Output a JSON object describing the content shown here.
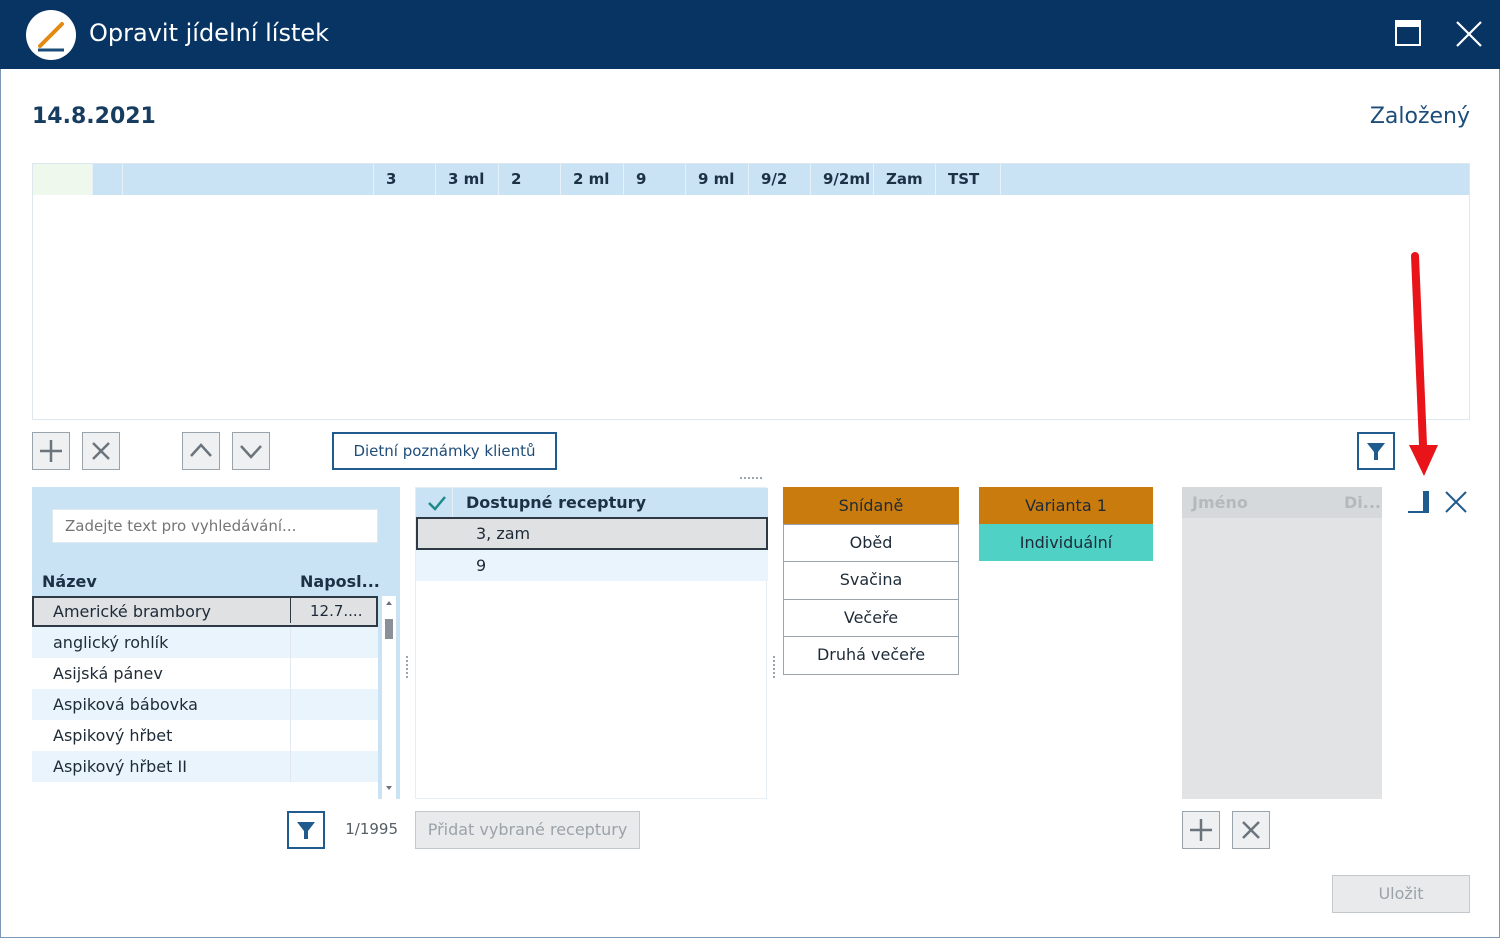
{
  "window": {
    "title": "Opravit jídelní lístek"
  },
  "header": {
    "date": "14.8.2021",
    "status": "Založený"
  },
  "menu_grid": {
    "columns": [
      "3",
      "3 ml",
      "2",
      "2 ml",
      "9",
      "9 ml",
      "9/2",
      "9/2ml",
      "Zam",
      "TST"
    ]
  },
  "toolbar": {
    "diet_notes_label": "Dietní poznámky klientů"
  },
  "recipe_search": {
    "placeholder": "Zadejte text pro vyhledávání..."
  },
  "recipe_table": {
    "col_name": "Název",
    "col_last": "Naposl...",
    "rows": [
      {
        "name": "Americké brambory",
        "last": "12.7...."
      },
      {
        "name": "anglický rohlík",
        "last": ""
      },
      {
        "name": "Asijská pánev",
        "last": ""
      },
      {
        "name": "Aspiková bábovka",
        "last": ""
      },
      {
        "name": "Aspikový hřbet",
        "last": ""
      },
      {
        "name": "Aspikový hřbet II",
        "last": ""
      }
    ],
    "count": "1/1995"
  },
  "available_recipes": {
    "header": "Dostupné receptury",
    "rows": [
      "3, zam",
      "9"
    ],
    "add_selected_label": "Přidat vybrané receptury"
  },
  "meals": [
    "Snídaně",
    "Oběd",
    "Svačina",
    "Večeře",
    "Druhá večeře"
  ],
  "variants": [
    "Varianta 1",
    "Individuální"
  ],
  "clients": {
    "col_name": "Jméno",
    "col_diet": "Di..."
  },
  "footer": {
    "save_label": "Uložit"
  },
  "colors": {
    "titlebar": "#073463",
    "header_blue": "#c9e2f4",
    "selected_orange": "#c97b0d",
    "individual_teal": "#4fd1c5",
    "annotation_red": "#e8141a"
  }
}
